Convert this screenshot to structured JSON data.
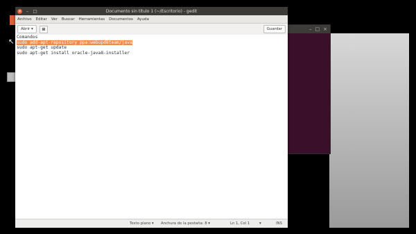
{
  "window": {
    "title": "Documento sin título 1 (~/Escritorio) - gedit",
    "buttons": [
      "×",
      "–",
      "□"
    ]
  },
  "menu": [
    "Archivo",
    "Editar",
    "Ver",
    "Buscar",
    "Herramientas",
    "Documentos",
    "Ayuda"
  ],
  "toolbar": {
    "open_label": "Abrir ▾",
    "new_tab_icon": "⊞",
    "save_label": "Guardar"
  },
  "editor": {
    "lines": [
      "Comandos",
      "sudo add-apt-repository ppa:webupd8team/java",
      "sudo apt-get update",
      "sudo apt-get install oracle-java8-installer"
    ]
  },
  "status": {
    "language": "Texto plano ▾",
    "tab_width": "Anchura de la pestaña: 8 ▾",
    "position": "Ln 1, Col 1",
    "position_arrow": "▾",
    "mode": "INS"
  },
  "bg_window": {
    "buttons": [
      "–",
      "□",
      "×"
    ]
  },
  "colors": {
    "titlebar": "#3c3b37",
    "close_button": "#e55d33",
    "selection": "#f08a4b",
    "terminal_bg": "#3a0f2a"
  }
}
